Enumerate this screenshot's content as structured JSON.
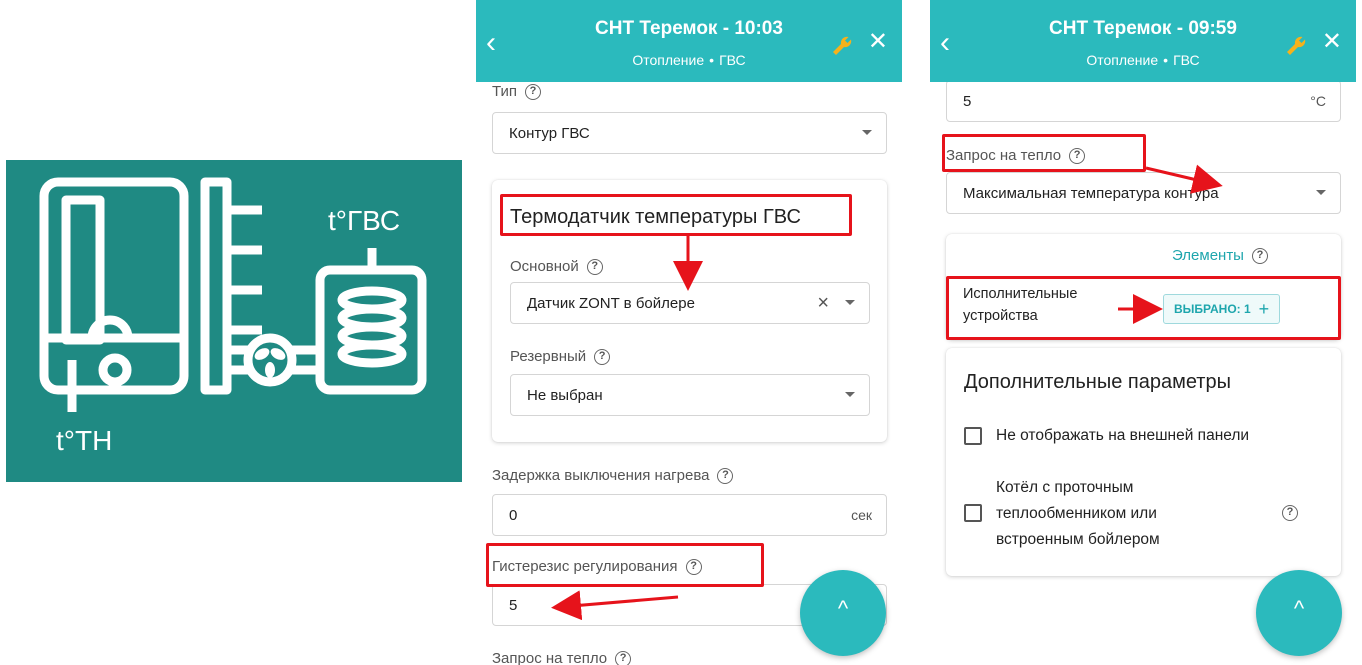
{
  "illustration": {
    "label_dhw": "t°ГВС",
    "label_hp": "t°ТН",
    "bg_color": "#1f8a83"
  },
  "panel1": {
    "header": {
      "title": "СНТ Теремок - 10:03",
      "tab1": "Отопление",
      "separator": "•",
      "tab2": "ГВС"
    },
    "type_label": "Тип",
    "type_value": "Контур ГВС",
    "sensor_card_title": "Термодатчик температуры ГВС",
    "primary_label": "Основной",
    "primary_value": "Датчик ZONT в бойлере",
    "reserve_label": "Резервный",
    "reserve_value": "Не выбран",
    "delay_label": "Задержка выключения нагрева",
    "delay_value": "0",
    "delay_unit": "сек",
    "hysteresis_label": "Гистерезис регулирования",
    "hysteresis_value": "5",
    "heat_request_label": "Запрос на тепло"
  },
  "panel2": {
    "header": {
      "title": "СНТ Теремок - 09:59",
      "tab1": "Отопление",
      "separator": "•",
      "tab2": "ГВС"
    },
    "temp_value": "5",
    "temp_unit": "°C",
    "heat_request_label": "Запрос на тепло",
    "heat_request_value": "Максимальная температура контура",
    "elements_title": "Элементы",
    "actuators_label_1": "Исполнительные",
    "actuators_label_2": "устройства",
    "selected_chip": "ВЫБРАНО: 1",
    "extra_title": "Дополнительные параметры",
    "checkbox1": "Не отображать на внешней панели",
    "checkbox2_line1": "Котёл с проточным",
    "checkbox2_line2": "теплообменником или",
    "checkbox2_line3": "встроенным бойлером"
  },
  "icons": {
    "back": "‹",
    "close": "✕",
    "help": "?",
    "clear": "×",
    "fab": "^",
    "plus": "+"
  },
  "colors": {
    "accent": "#2bbabd",
    "highlight": "#e6131b",
    "link": "#1ea6ad"
  }
}
